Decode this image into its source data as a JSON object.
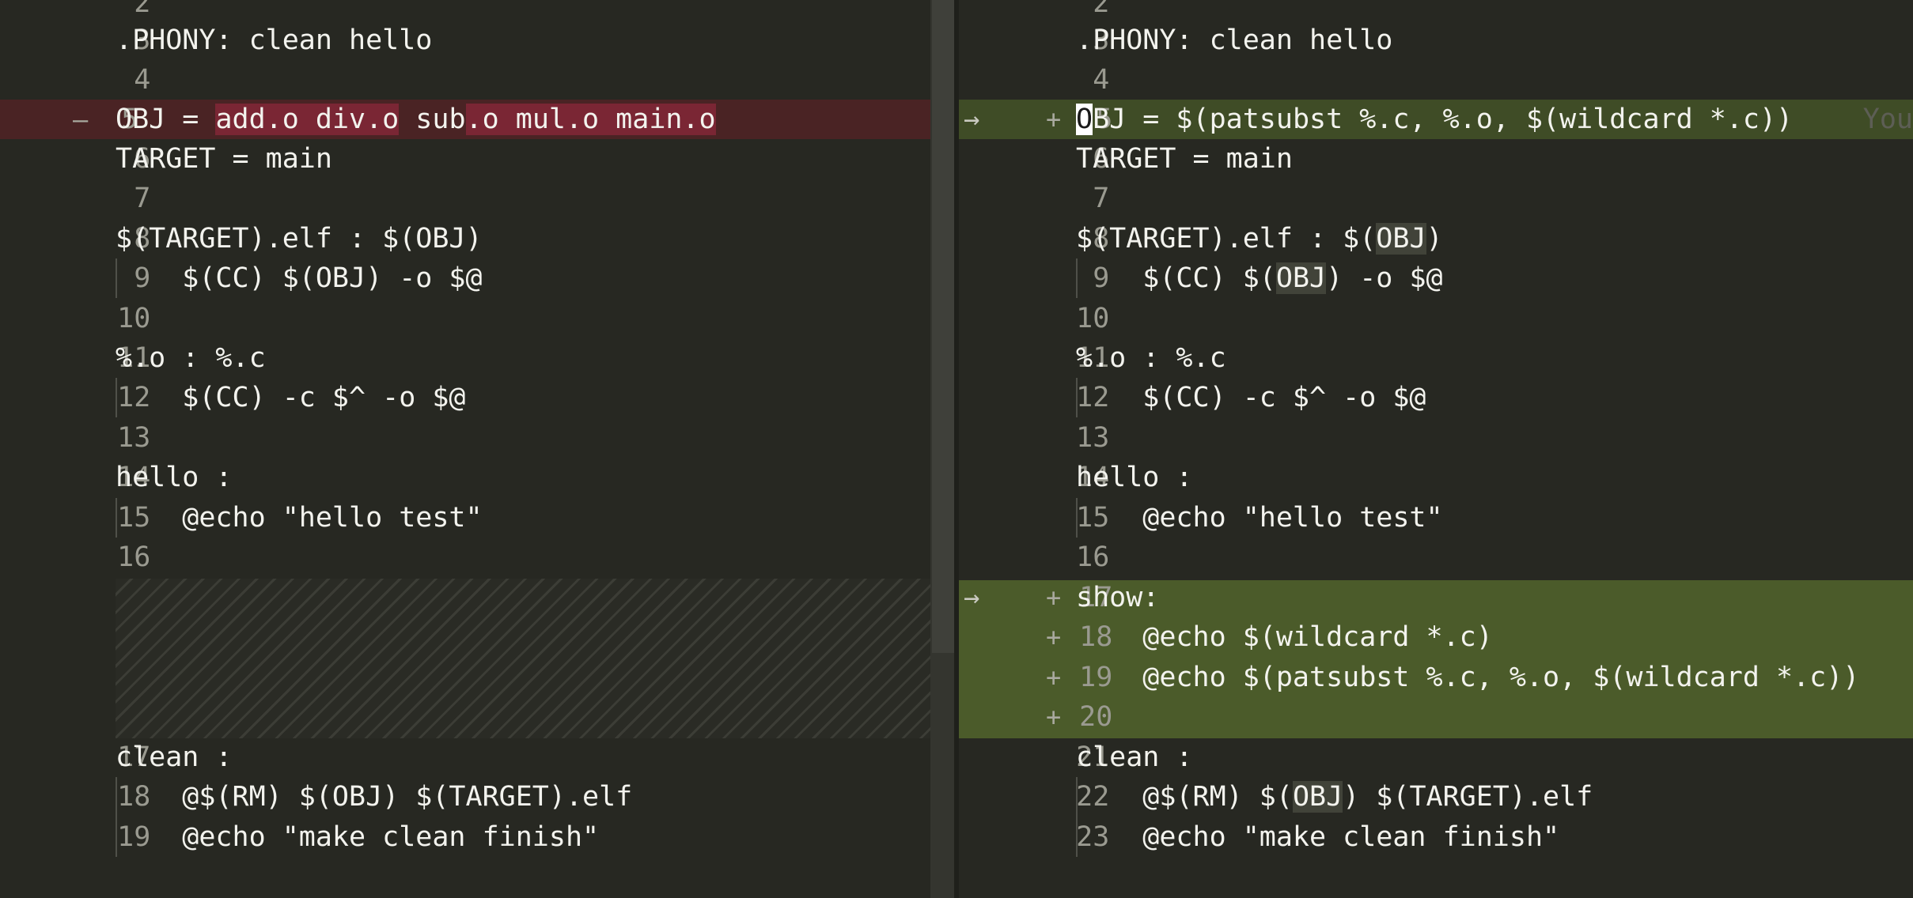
{
  "left": {
    "lines": [
      {
        "num": "2",
        "code": ""
      },
      {
        "num": "3",
        "code": ".PHONY: clean hello"
      },
      {
        "num": "4",
        "code": ""
      },
      {
        "num": "5",
        "marker": "—",
        "seg": [
          "OBJ = ",
          "add.o div.o",
          " sub",
          ".o mul.o main.o"
        ]
      },
      {
        "num": "6",
        "code": "TARGET = main"
      },
      {
        "num": "7",
        "code": ""
      },
      {
        "num": "8",
        "code": "$(TARGET).elf : $(OBJ)"
      },
      {
        "num": "9",
        "code": "    $(CC) $(OBJ) -o $@"
      },
      {
        "num": "10",
        "code": ""
      },
      {
        "num": "11",
        "code": "%.o : %.c"
      },
      {
        "num": "12",
        "code": "    $(CC) -c $^ -o $@"
      },
      {
        "num": "13",
        "code": ""
      },
      {
        "num": "14",
        "code": "hello :"
      },
      {
        "num": "15",
        "code": "    @echo \"hello test\""
      },
      {
        "num": "16",
        "code": ""
      },
      {
        "num": "17",
        "code": "clean :"
      },
      {
        "num": "18",
        "code": "    @$(RM) $(OBJ) $(TARGET).elf"
      },
      {
        "num": "19",
        "code": "    @echo \"make clean finish\""
      }
    ]
  },
  "right": {
    "lines": [
      {
        "num": "2",
        "code": ""
      },
      {
        "num": "3",
        "code": ".PHONY: clean hello"
      },
      {
        "num": "4",
        "code": ""
      },
      {
        "num": "5",
        "marker": "+",
        "arrow": "→",
        "first_char": "O",
        "rest": "BJ = $(patsubst %.c, %.o, $(wildcard *.c))",
        "ghost": "You"
      },
      {
        "num": "6",
        "code": "TARGET = main"
      },
      {
        "num": "7",
        "code": ""
      },
      {
        "num": "8",
        "seg": [
          "$(TARGET).elf : $(",
          "OBJ",
          ")"
        ]
      },
      {
        "num": "9",
        "seg": [
          "    $(CC) $(",
          "OBJ",
          ") -o $@"
        ]
      },
      {
        "num": "10",
        "code": ""
      },
      {
        "num": "11",
        "code": "%.o : %.c"
      },
      {
        "num": "12",
        "code": "    $(CC) -c $^ -o $@"
      },
      {
        "num": "13",
        "code": ""
      },
      {
        "num": "14",
        "code": "hello :"
      },
      {
        "num": "15",
        "code": "    @echo \"hello test\""
      },
      {
        "num": "16",
        "code": ""
      },
      {
        "num": "17",
        "marker": "+",
        "arrow": "→",
        "code": "show:"
      },
      {
        "num": "18",
        "marker": "+",
        "code": "    @echo $(wildcard *.c)"
      },
      {
        "num": "19",
        "marker": "+",
        "code": "    @echo $(patsubst %.c, %.o, $(wildcard *.c))"
      },
      {
        "num": "20",
        "marker": "+",
        "code": ""
      },
      {
        "num": "21",
        "code": "clean :"
      },
      {
        "num": "22",
        "seg": [
          "    @$(RM) $(",
          "OBJ",
          ") $(TARGET).elf"
        ]
      },
      {
        "num": "23",
        "code": "    @echo \"make clean finish\""
      }
    ]
  },
  "colors": {
    "background": "#272822",
    "deleted_line": "#4a2324",
    "deleted_word": "#7a2634",
    "added_line": "#3f4c26",
    "added_block": "#4b5b2a"
  }
}
